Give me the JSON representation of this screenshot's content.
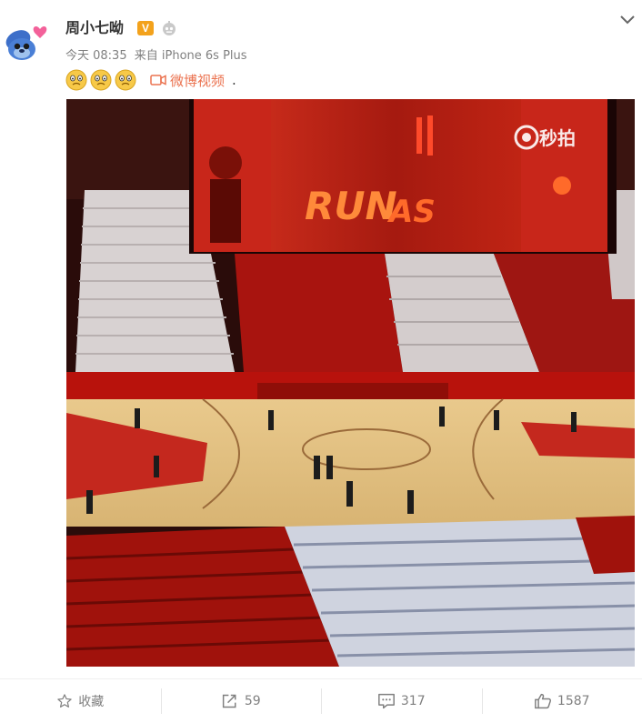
{
  "post": {
    "username": "周小七呦",
    "verified_badge": "V",
    "time": "今天 08:35",
    "source": "来自 iPhone 6s Plus",
    "emoji_count": 3,
    "video_link_label": "微博视频",
    "trailing_text": ".",
    "video_watermark": "秒拍"
  },
  "actions": {
    "favorite_label": "收藏",
    "repost_count": "59",
    "comment_count": "317",
    "like_count": "1587"
  },
  "colors": {
    "link_orange": "#eb7350",
    "badge_gold": "#f3a21c",
    "meta_gray": "#808080"
  },
  "icons": [
    "stitch-avatar-icon",
    "verified-badge-icon",
    "robot-icon",
    "chevron-down-icon",
    "emoji-icon",
    "video-icon",
    "star-icon",
    "repost-icon",
    "comment-icon",
    "thumbs-up-icon"
  ]
}
